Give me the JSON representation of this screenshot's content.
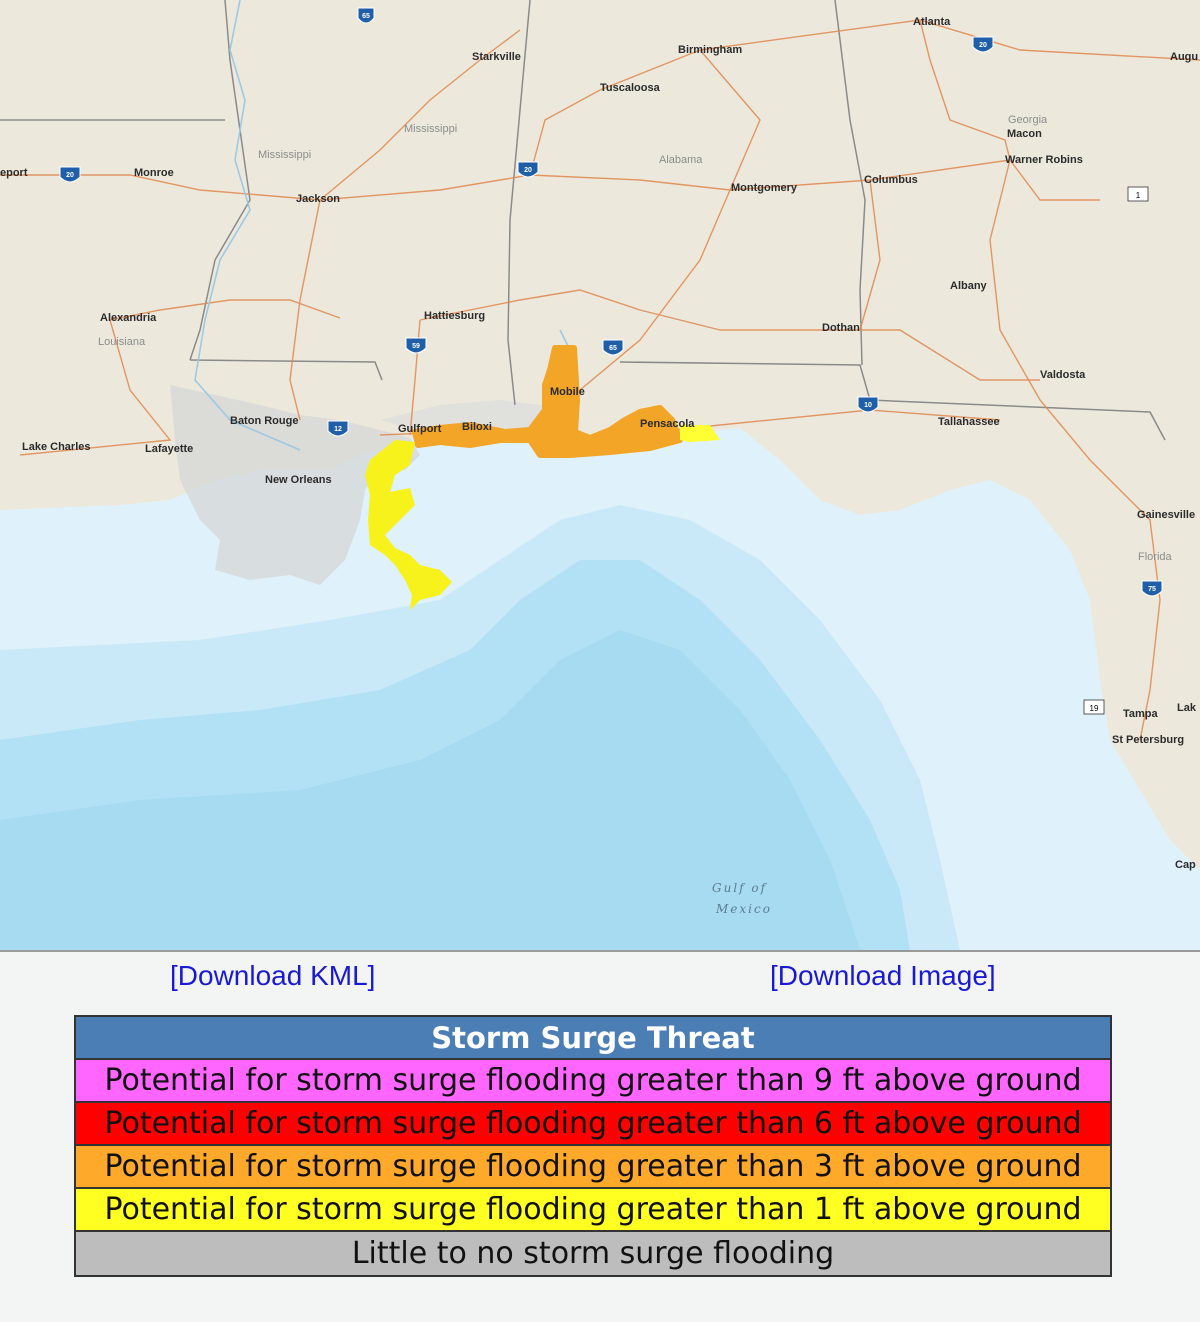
{
  "map": {
    "cities": [
      {
        "name": "Atlanta"
      },
      {
        "name": "Birmingham"
      },
      {
        "name": "Starkville"
      },
      {
        "name": "Tuscaloosa"
      },
      {
        "name": "Augu"
      },
      {
        "name": "Macon"
      },
      {
        "name": "Warner Robins"
      },
      {
        "name": "Monroe"
      },
      {
        "name": "eport"
      },
      {
        "name": "Jackson"
      },
      {
        "name": "Montgomery"
      },
      {
        "name": "Columbus"
      },
      {
        "name": "Albany"
      },
      {
        "name": "Alexandria"
      },
      {
        "name": "Hattiesburg"
      },
      {
        "name": "Dothan"
      },
      {
        "name": "Valdosta"
      },
      {
        "name": "Mobile"
      },
      {
        "name": "Baton Rouge"
      },
      {
        "name": "Gulfport"
      },
      {
        "name": "Biloxi"
      },
      {
        "name": "Pensacola"
      },
      {
        "name": "Tallahassee"
      },
      {
        "name": "Lake Charles"
      },
      {
        "name": "Lafayette"
      },
      {
        "name": "New Orleans"
      },
      {
        "name": "Gainesville"
      },
      {
        "name": "Tampa"
      },
      {
        "name": "Lak"
      },
      {
        "name": "St Petersburg"
      },
      {
        "name": "Cap"
      }
    ],
    "states": [
      {
        "name": "Mississippi"
      },
      {
        "name": "Mississippi"
      },
      {
        "name": "Alabama"
      },
      {
        "name": "Georgia"
      },
      {
        "name": "Louisiana"
      },
      {
        "name": "Florida"
      }
    ],
    "water_label_1": "Gulf of",
    "water_label_2": "Mexico",
    "shields": [
      "65",
      "20",
      "20",
      "20",
      "59",
      "65",
      "10",
      "12",
      "10",
      "75",
      "75",
      "1",
      "19"
    ]
  },
  "links": {
    "download_kml": "[Download KML]",
    "download_image": "[Download Image]"
  },
  "legend": {
    "title": "Storm Surge Threat",
    "title_color": "#4a7eb5",
    "rows": [
      {
        "label": "Potential for storm surge flooding greater than 9 ft above ground",
        "color": "#ff66ff"
      },
      {
        "label": "Potential for storm surge flooding greater than 6 ft above ground",
        "color": "#ff0000"
      },
      {
        "label": "Potential for storm surge flooding greater than 3 ft above ground",
        "color": "#ffa92b"
      },
      {
        "label": "Potential for storm surge flooding greater than 1 ft above ground",
        "color": "#ffff22"
      },
      {
        "label": "Little to no storm surge flooding",
        "color": "#bdbdbd"
      }
    ]
  }
}
